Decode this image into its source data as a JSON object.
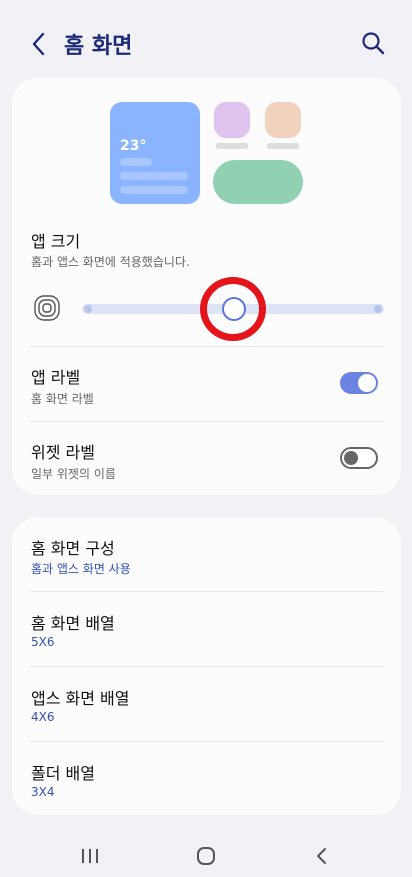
{
  "header": {
    "title": "홈 화면"
  },
  "preview": {
    "temperature": "23°"
  },
  "app_size": {
    "title": "앱 크기",
    "subtitle": "홈과 앱스 화면에 적용했습니다."
  },
  "app_label": {
    "title": "앱 라벨",
    "subtitle": "홈 화면 라벨",
    "enabled": true
  },
  "widget_label": {
    "title": "위젯 라벨",
    "subtitle": "일부 위젯의 이름",
    "enabled": false
  },
  "settings": [
    {
      "title": "홈 화면 구성",
      "value": "홈과 앱스 화면 사용"
    },
    {
      "title": "홈 화면 배열",
      "value": "5X6"
    },
    {
      "title": "앱스 화면 배열",
      "value": "4X6"
    },
    {
      "title": "폴더 배열",
      "value": "3X4"
    }
  ],
  "colors": {
    "accent": "#6b84e3",
    "title": "#1d2b7a",
    "highlight": "#e3141a"
  }
}
